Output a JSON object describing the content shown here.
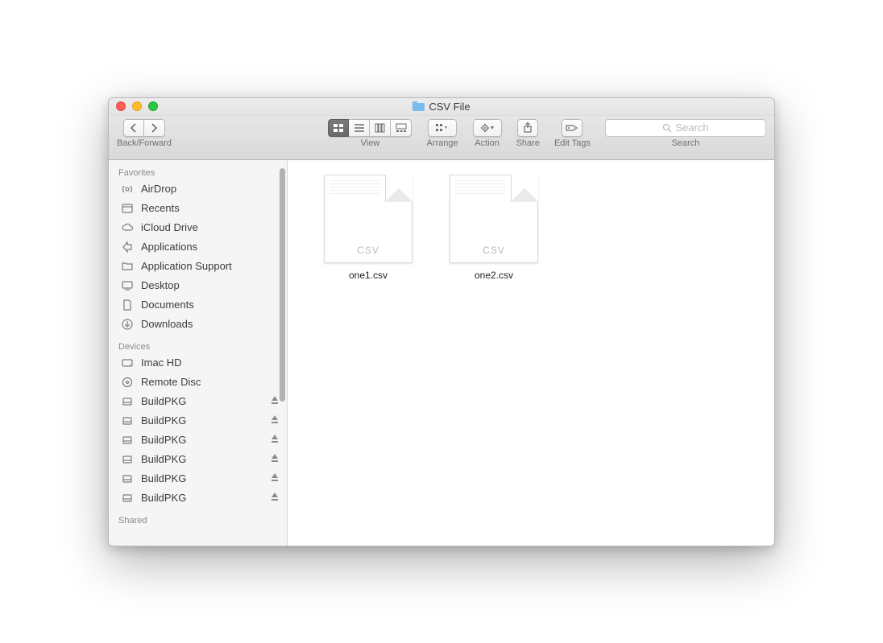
{
  "window": {
    "title": "CSV File"
  },
  "toolbar": {
    "nav_label": "Back/Forward",
    "view_label": "View",
    "arrange_label": "Arrange",
    "action_label": "Action",
    "share_label": "Share",
    "tags_label": "Edit Tags",
    "search_label": "Search",
    "search_placeholder": "Search"
  },
  "sidebar": {
    "sections": [
      {
        "header": "Favorites",
        "items": [
          {
            "icon": "airdrop",
            "label": "AirDrop"
          },
          {
            "icon": "recents",
            "label": "Recents"
          },
          {
            "icon": "icloud",
            "label": "iCloud Drive"
          },
          {
            "icon": "apps",
            "label": "Applications"
          },
          {
            "icon": "folder",
            "label": "Application Support"
          },
          {
            "icon": "desktop",
            "label": "Desktop"
          },
          {
            "icon": "documents",
            "label": "Documents"
          },
          {
            "icon": "downloads",
            "label": "Downloads"
          }
        ]
      },
      {
        "header": "Devices",
        "items": [
          {
            "icon": "hd",
            "label": "Imac HD"
          },
          {
            "icon": "disc",
            "label": "Remote Disc"
          },
          {
            "icon": "ext",
            "label": "BuildPKG",
            "eject": true
          },
          {
            "icon": "ext",
            "label": "BuildPKG",
            "eject": true
          },
          {
            "icon": "ext",
            "label": "BuildPKG",
            "eject": true
          },
          {
            "icon": "ext",
            "label": "BuildPKG",
            "eject": true
          },
          {
            "icon": "ext",
            "label": "BuildPKG",
            "eject": true
          },
          {
            "icon": "ext",
            "label": "BuildPKG",
            "eject": true
          }
        ]
      },
      {
        "header": "Shared",
        "items": []
      }
    ]
  },
  "files": [
    {
      "name": "one1.csv",
      "badge": "CSV"
    },
    {
      "name": "one2.csv",
      "badge": "CSV"
    }
  ]
}
